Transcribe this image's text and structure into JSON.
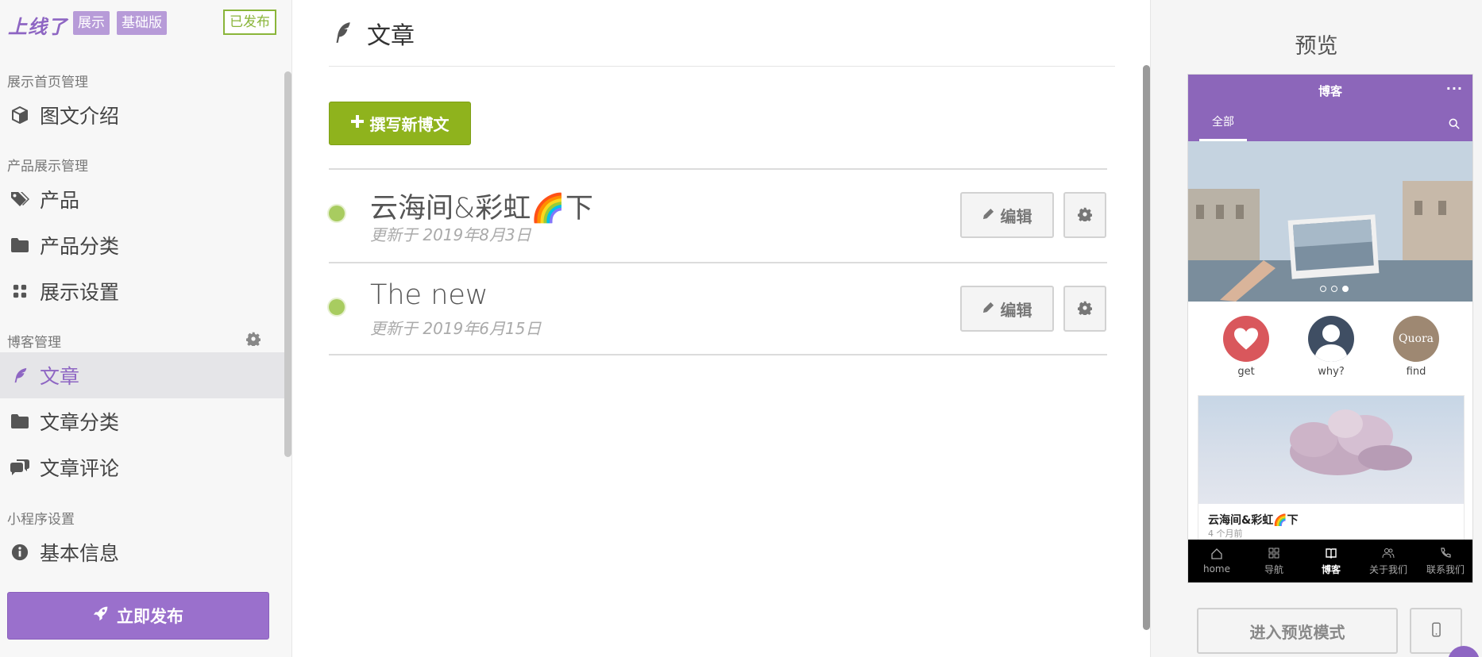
{
  "sidebar": {
    "logo": "上线了",
    "tags": [
      "展示",
      "基础版"
    ],
    "status": "已发布",
    "sections": {
      "home": "展示首页管理",
      "product": "产品展示管理",
      "blog": "博客管理",
      "miniapp": "小程序设置"
    },
    "items": {
      "graphic_intro": "图文介绍",
      "products": "产品",
      "product_categories": "产品分类",
      "display_settings": "展示设置",
      "articles": "文章",
      "article_categories": "文章分类",
      "article_comments": "文章评论",
      "basic_info": "基本信息"
    },
    "publish_button": "立即发布"
  },
  "main": {
    "title": "文章",
    "new_post_button": "撰写新博文",
    "edit_label": "编辑",
    "posts": [
      {
        "title": "云海间&彩虹🌈下",
        "updated": "更新于 2019年8月3日"
      },
      {
        "title": "The new",
        "updated": "更新于 2019年6月15日"
      }
    ]
  },
  "preview": {
    "title": "预览",
    "phone": {
      "header": "博客",
      "menu": "···",
      "tab": "全部",
      "icons": [
        {
          "label": "get"
        },
        {
          "label": "why?"
        },
        {
          "label": "find",
          "text": "Quora"
        }
      ],
      "card_title": "云海间&彩虹🌈下",
      "card_date": "4 个月前",
      "nav": [
        "home",
        "导航",
        "博客",
        "关于我们",
        "联系我们"
      ],
      "active_nav": "博客"
    },
    "enter_preview_button": "进入预览模式"
  },
  "colors": {
    "accent": "#8e66c3",
    "green": "#8fb31d",
    "published": "#8ab53a"
  }
}
